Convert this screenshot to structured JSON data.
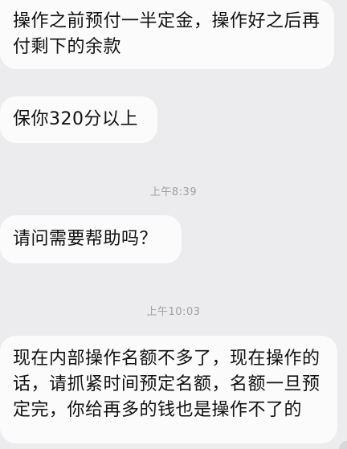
{
  "messages": [
    {
      "text": "操作之前预付一半定金，操作好之后再付剩下的余款"
    },
    {
      "text": "保你320分以上"
    },
    {
      "text": "请问需要帮助吗？"
    },
    {
      "text": "现在内部操作名额不多了，现在操作的话，请抓紧时间预定名额，名额一旦预定完，你给再多的钱也是操作不了的"
    }
  ],
  "timestamps": [
    {
      "text": "上午8:39"
    },
    {
      "text": "上午10:03"
    }
  ]
}
